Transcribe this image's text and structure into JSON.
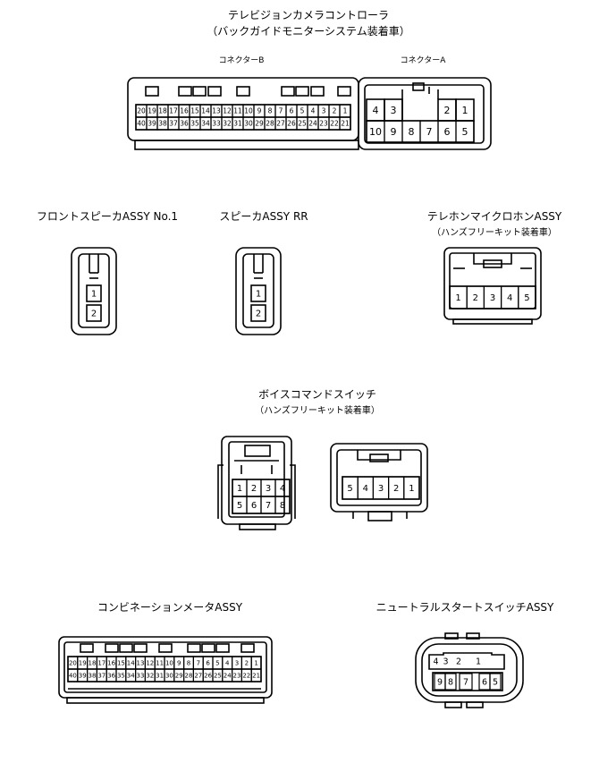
{
  "camera_controller": {
    "title": "テレビジョンカメラコントローラ",
    "subtitle": "（バックガイドモニターシステム装着車）",
    "connector_b_label": "コネクターB",
    "connector_a_label": "コネクターA",
    "b_top_pins": [
      "20",
      "19",
      "18",
      "17",
      "16",
      "15",
      "14",
      "13",
      "12",
      "11",
      "10",
      "9",
      "8",
      "7",
      "6",
      "5",
      "4",
      "3",
      "2",
      "1"
    ],
    "b_bottom_pins": [
      "40",
      "39",
      "38",
      "37",
      "36",
      "35",
      "34",
      "33",
      "32",
      "31",
      "30",
      "29",
      "28",
      "27",
      "26",
      "25",
      "24",
      "23",
      "22",
      "21"
    ],
    "a_top_pins": [
      "4",
      "3",
      "",
      "",
      "2",
      "1"
    ],
    "a_bottom_pins": [
      "10",
      "9",
      "8",
      "7",
      "6",
      "5"
    ]
  },
  "front_speaker": {
    "title": "フロントスピーカASSY No.1",
    "pins": [
      "1",
      "2"
    ]
  },
  "speaker_rr": {
    "title": "スピーカASSY RR",
    "pins": [
      "1",
      "2"
    ]
  },
  "telephone_mic": {
    "title": "テレホンマイクロホンASSY",
    "subtitle": "（ハンズフリーキット装着車）",
    "pins": [
      "1",
      "2",
      "3",
      "4",
      "5"
    ]
  },
  "voice_command": {
    "title": "ボイスコマンドスイッチ",
    "subtitle": "（ハンズフリーキット装着車）",
    "left_top_pins": [
      "1",
      "2",
      "3",
      "4"
    ],
    "left_bottom_pins": [
      "5",
      "6",
      "7",
      "8"
    ],
    "right_pins": [
      "5",
      "4",
      "3",
      "2",
      "1"
    ]
  },
  "combination_meter": {
    "title": "コンビネーションメータASSY",
    "top_pins": [
      "20",
      "19",
      "18",
      "17",
      "16",
      "15",
      "14",
      "13",
      "12",
      "11",
      "10",
      "9",
      "8",
      "7",
      "6",
      "5",
      "4",
      "3",
      "2",
      "1"
    ],
    "bottom_pins": [
      "40",
      "39",
      "38",
      "37",
      "36",
      "35",
      "34",
      "33",
      "32",
      "31",
      "30",
      "29",
      "28",
      "27",
      "26",
      "25",
      "24",
      "23",
      "22",
      "21"
    ]
  },
  "neutral_start": {
    "title": "ニュートラルスタートスイッチASSY",
    "top_pins": [
      "4",
      "3",
      "2",
      "1"
    ],
    "bottom_pins": [
      "9",
      "8",
      "7",
      "6",
      "5"
    ]
  }
}
